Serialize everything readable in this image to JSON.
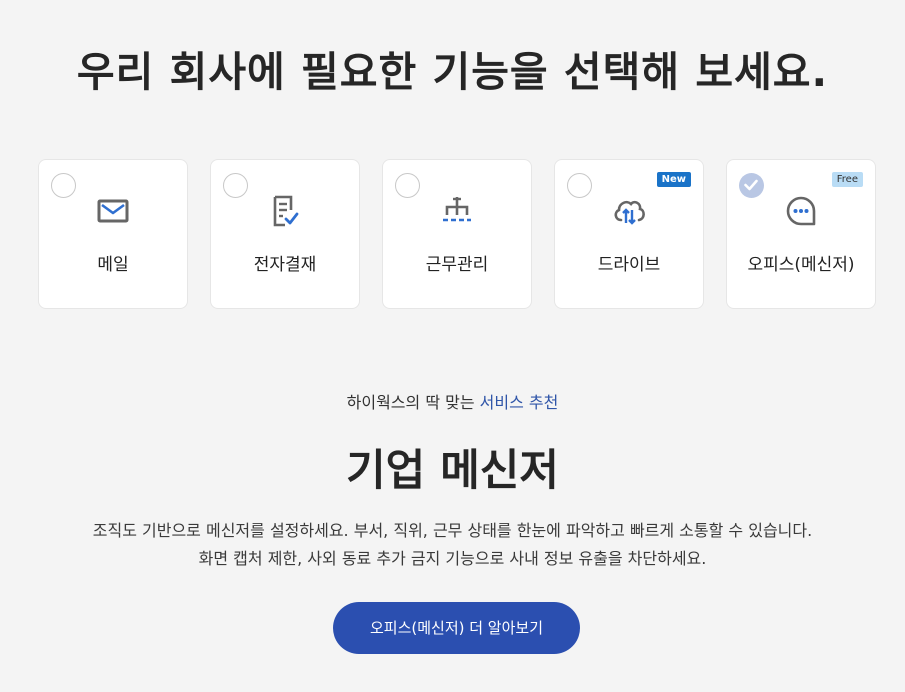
{
  "headline": "우리 회사에 필요한 기능을 선택해 보세요.",
  "features": [
    {
      "label": "메일",
      "icon": "mail-icon",
      "selected": false
    },
    {
      "label": "전자결재",
      "icon": "approval-document-icon",
      "selected": false
    },
    {
      "label": "근무관리",
      "icon": "org-chart-icon",
      "selected": false
    },
    {
      "label": "드라이브",
      "icon": "cloud-sync-icon",
      "selected": false,
      "badge": "New"
    },
    {
      "label": "오피스(메신저)",
      "icon": "chat-bubble-icon",
      "selected": true,
      "badge": "Free"
    }
  ],
  "recommend": {
    "subtitle_prefix": "하이웍스의 딱 맞는",
    "subtitle_accent": "서비스 추천",
    "title": "기업 메신저",
    "desc_line1": "조직도 기반으로 메신저를 설정하세요. 부서, 직위, 근무 상태를 한눈에 파악하고 빠르게 소통할 수 있습니다.",
    "desc_line2": "화면 캡처 제한, 사외 동료 추가 금지 기능으로 사내 정보 유출을 차단하세요.",
    "cta_label": "오피스(메신저) 더 알아보기"
  },
  "colors": {
    "background": "#f4f4f4",
    "accent": "#2f55a8",
    "button": "#2b4fb0",
    "icon_gray": "#666666",
    "icon_blue": "#2f6fd0",
    "badge_new": "#1a73c8",
    "badge_free": "#b9dcf5",
    "checked": "#b9c7e4"
  }
}
